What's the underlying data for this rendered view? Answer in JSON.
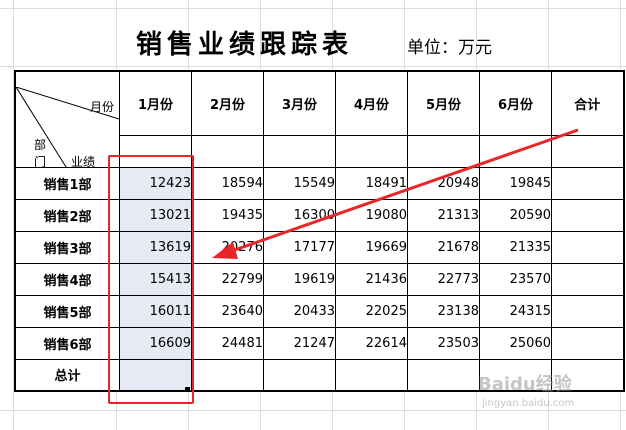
{
  "title": "销售业绩跟踪表",
  "unit_label": "单位：万元",
  "corner": {
    "month": "月份",
    "dept": "部\n门",
    "perf": "业绩"
  },
  "months": [
    "1月份",
    "2月份",
    "3月份",
    "4月份",
    "5月份",
    "6月份"
  ],
  "total_col_label": "合计",
  "rows": [
    {
      "dept": "销售1部",
      "values": [
        "12423",
        "18594",
        "15549",
        "18491",
        "20948",
        "19845"
      ]
    },
    {
      "dept": "销售2部",
      "values": [
        "13021",
        "19435",
        "16300",
        "19080",
        "21313",
        "20590"
      ]
    },
    {
      "dept": "销售3部",
      "values": [
        "13619",
        "20276",
        "17177",
        "19669",
        "21678",
        "21335"
      ]
    },
    {
      "dept": "销售4部",
      "values": [
        "15413",
        "22799",
        "19619",
        "21436",
        "22773",
        "23570"
      ]
    },
    {
      "dept": "销售5部",
      "values": [
        "16011",
        "23640",
        "20433",
        "22025",
        "23138",
        "24315"
      ]
    },
    {
      "dept": "销售6部",
      "values": [
        "16609",
        "24481",
        "21247",
        "22614",
        "23503",
        "25060"
      ]
    }
  ],
  "total_row_label": "总计",
  "annotation": {
    "box_color": "#e8262a",
    "arrow_color": "#e8262a"
  },
  "watermark": {
    "brand": "Baidu经验",
    "url": "jingyan.baidu.com"
  }
}
